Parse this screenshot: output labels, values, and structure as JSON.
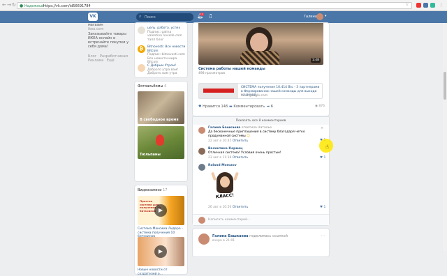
{
  "browser": {
    "secure_label": "Надежный",
    "url": "https://vk.com/id56691784"
  },
  "header": {
    "search_placeholder": "Поиск",
    "user_name": "Галина",
    "notification_count": "1"
  },
  "left": {
    "ad_title": "магазин",
    "ad_domain": "ikea.com",
    "ad_text": "Заказывайте товары ИКЕА онлайн и встречайте покупки у себя дома!",
    "footer": [
      "Блог",
      "Разработчикам",
      "Реклама",
      "Ещё"
    ]
  },
  "recommendations": [
    {
      "title": "цель. работа. успех",
      "desc": "Подпис: galina valentina novelle.com тапп блог"
    },
    {
      "title": "Bitnovosti: Все новости Bitcoin",
      "desc": "Подпис: bitnovosti.com Все новости мира Bitcoin"
    },
    {
      "title": "С Добрым Утром!",
      "desc": "Доброго утра вам! Доброго вам утра"
    }
  ],
  "photos": {
    "title": "Фотоальбомы",
    "count": "4",
    "items": [
      {
        "caption": "В свободное время"
      },
      {
        "caption": "Тюльпаны"
      }
    ]
  },
  "videos": {
    "title": "Видеозаписи",
    "count": "17",
    "items": [
      {
        "caption": "Система Максима Лидера - система получения 10 биткоинов",
        "overlay": "Простая система для получения 10 биткоинов"
      },
      {
        "caption": "Новые новости от создателей о...",
        "overlay": ""
      }
    ]
  },
  "post": {
    "video_duration": "1:48",
    "video_title": "Система работы нашей команды",
    "video_views": "498 просмотров",
    "link_title": "СИСТЕМА получения 10.414 Btc - 3 партнерами в Формировании нашей команды для выхода на доход",
    "link_domain": "docs.google.com",
    "likes_label": "Нравится",
    "likes_count": "148",
    "comment_label": "Комментировать",
    "share_count": "6",
    "views_count": "876",
    "show_all": "Показать все 8 комментариев"
  },
  "comments": [
    {
      "author": "Галина Башкаева",
      "reply_to": "ответила Наталье",
      "text": "Да бесконечные приглашения в систему благодаря четко продуманной системы",
      "date": "22 авг в 10:45",
      "reply": "Ответить",
      "likes": "2"
    },
    {
      "author": "Валентина Кормец",
      "reply_to": "",
      "text": "Отличная система! Условия очень простые!",
      "date": "23 авг в 11:38",
      "reply": "Ответить",
      "likes": "1"
    },
    {
      "author": "Roland Morozov",
      "reply_to": "",
      "text": "",
      "sticker_text": "КЛАСС!",
      "date": "26 авг в 10:50",
      "reply": "Ответить",
      "likes": "1"
    }
  ],
  "comment_input_placeholder": "Написать комментарий...",
  "next_post": {
    "author": "Галина Башкаева",
    "action": "поделилась ссылкой",
    "date": "вчера в 21:01"
  },
  "colors": {
    "vk_blue": "#4a76a8",
    "link": "#2a5885",
    "bg": "#edeef0",
    "cursor_highlight": "#ffe600"
  }
}
